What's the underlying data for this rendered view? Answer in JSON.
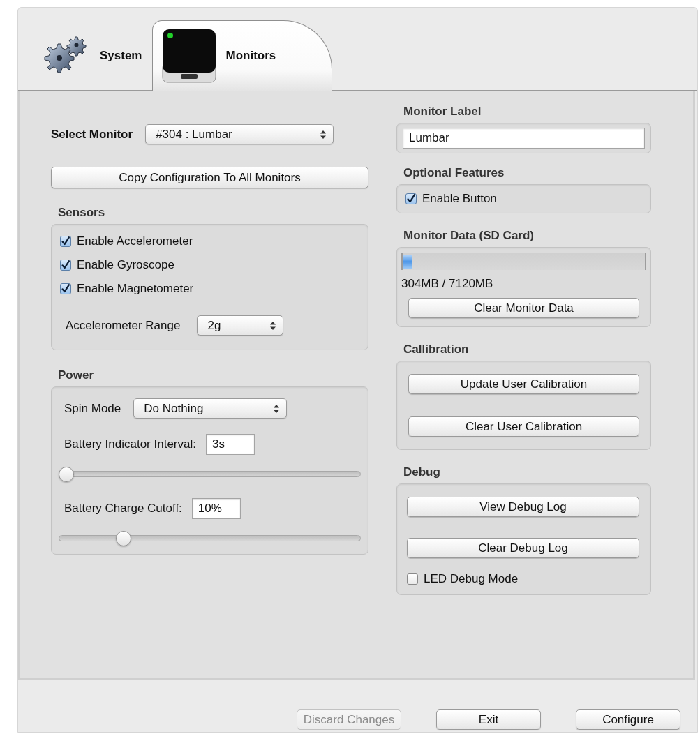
{
  "tabs": [
    {
      "label": "System",
      "kind": "gears",
      "selected": false
    },
    {
      "label": "Monitors",
      "kind": "device",
      "selected": true
    }
  ],
  "left": {
    "select_monitor": {
      "label": "Select Monitor",
      "value": "#304 : Lumbar"
    },
    "copy_button": "Copy Configuration To All Monitors",
    "sensors": {
      "title": "Sensors",
      "checkboxes": [
        {
          "label": "Enable Accelerometer",
          "checked": true
        },
        {
          "label": "Enable Gyroscope",
          "checked": true
        },
        {
          "label": "Enable Magnetometer",
          "checked": true
        }
      ],
      "range": {
        "label": "Accelerometer Range",
        "value": "2g"
      }
    },
    "power": {
      "title": "Power",
      "spin_mode": {
        "label": "Spin Mode",
        "value": "Do Nothing"
      },
      "sliders": [
        {
          "label": "Battery Indicator Interval:",
          "value": "3s",
          "level": 0.0
        },
        {
          "label": "Battery Charge Cutoff:",
          "value": "10%",
          "level": 0.2
        }
      ]
    }
  },
  "right": {
    "monitor_label": {
      "title": "Monitor Label",
      "value": "Lumbar"
    },
    "optional_features": {
      "title": "Optional Features",
      "checkboxes": [
        {
          "label": "Enable Button",
          "checked": true
        }
      ]
    },
    "monitor_data": {
      "title": "Monitor Data (SD Card)",
      "level": 0.04,
      "reading": "304MB / 7120MB",
      "button": "Clear Monitor Data"
    },
    "calibration": {
      "title": "Callibration",
      "buttons": [
        "Update User Calibration",
        "Clear User Calibration"
      ]
    },
    "debug": {
      "title": "Debug",
      "buttons": [
        "View Debug Log",
        "Clear Debug Log"
      ],
      "checkboxes": [
        {
          "label": "LED Debug Mode",
          "checked": false
        }
      ]
    }
  },
  "footer_buttons": [
    {
      "label": "Discard Changes",
      "disabled": true
    },
    {
      "label": "Exit",
      "disabled": false
    },
    {
      "label": "Configure",
      "disabled": false
    }
  ]
}
